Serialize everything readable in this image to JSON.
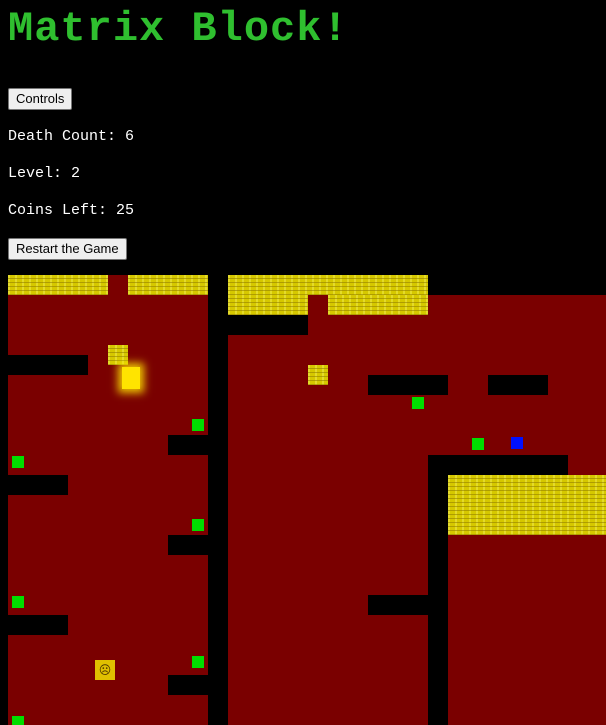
{
  "header": {
    "title": "Matrix Block!"
  },
  "controls_button": "Controls",
  "stats": {
    "death_label": "Death Count:",
    "death_count": "6",
    "level_label": "Level:",
    "level": "2",
    "coins_label": "Coins Left:",
    "coins_left": "25"
  },
  "restart_button": "Restart the Game",
  "colors": {
    "title": "#2fbf2f",
    "floor": "#7a0000",
    "wall": "#000000",
    "hazard": "#d6c800",
    "coin": "#00dd00",
    "player": "#ffe400",
    "goal": "#0010ff"
  },
  "icons": {
    "enemy": "frowning-block-icon"
  }
}
